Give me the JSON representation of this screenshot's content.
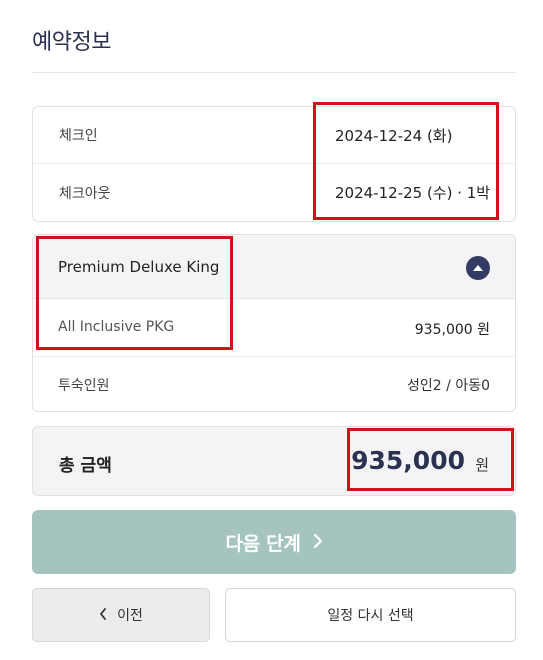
{
  "section_title": "예약정보",
  "dates": {
    "checkin_label": "체크인",
    "checkin_value": "2024-12-24 (화)",
    "checkout_label": "체크아웃",
    "checkout_value": "2024-12-25 (수) · 1박"
  },
  "room": {
    "name": "Premium Deluxe King",
    "collapse_icon": "chevron-up-icon",
    "package_name": "All Inclusive PKG",
    "package_price": "935,000 원",
    "guests_label": "투숙인원",
    "guests_value": "성인2 / 아동0"
  },
  "total": {
    "label": "총 금액",
    "amount": "935,000",
    "unit": "원"
  },
  "actions": {
    "next_label": "다음 단계",
    "next_icon": "chevron-right-icon",
    "prev_label": "이전",
    "prev_icon": "chevron-left-icon",
    "reselect_label": "일정 다시 선택"
  },
  "colors": {
    "title_navy": "#2b3250",
    "collapse_button": "#333a63",
    "next_button": "#a5c4bf",
    "highlight_red": "#d0121b"
  }
}
